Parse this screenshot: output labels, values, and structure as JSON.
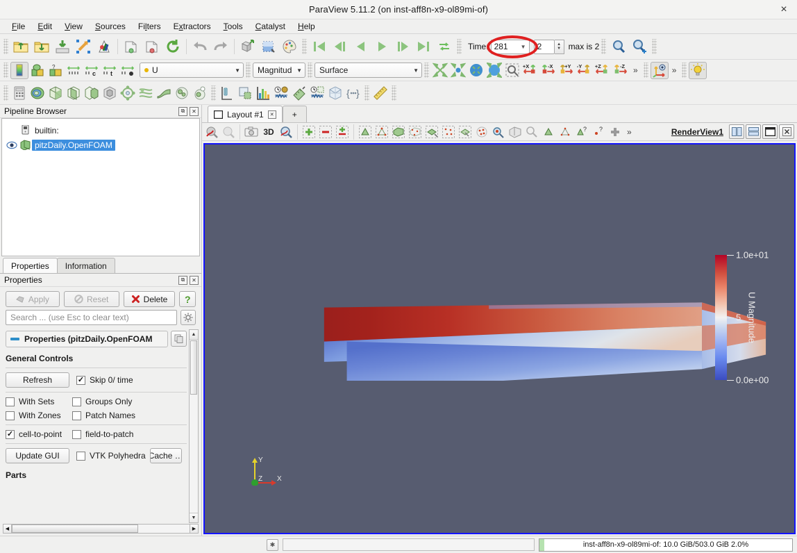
{
  "window": {
    "title": "ParaView 5.11.2 (on inst-aff8n-x9-ol89mi-of)",
    "close_label": "×"
  },
  "menubar": {
    "items": [
      {
        "label": "File",
        "mnemonic": "F"
      },
      {
        "label": "Edit",
        "mnemonic": "E"
      },
      {
        "label": "View",
        "mnemonic": "V"
      },
      {
        "label": "Sources",
        "mnemonic": "S"
      },
      {
        "label": "Filters",
        "mnemonic": "l"
      },
      {
        "label": "Extractors",
        "mnemonic": "x"
      },
      {
        "label": "Tools",
        "mnemonic": "T"
      },
      {
        "label": "Catalyst",
        "mnemonic": "C"
      },
      {
        "label": "Help",
        "mnemonic": "H"
      }
    ]
  },
  "main_toolbar": {
    "icons": [
      "open-file-icon",
      "save-state-icon",
      "save-data-icon",
      "connect-icon",
      "disconnect-icon",
      "load-state-icon",
      "save-screenshot-icon",
      "reset-session-icon",
      "undo-icon",
      "redo-icon",
      "undo-camera-icon",
      "redo-camera-icon",
      "edit-color-map-icon"
    ],
    "vcr": [
      "first-frame-icon",
      "previous-frame-icon",
      "play-reverse-icon",
      "play-icon",
      "next-frame-icon",
      "last-frame-icon",
      "loop-icon"
    ],
    "time_label": "Time:",
    "time_value": "281",
    "frame_index": "2",
    "max_label": "max is 2",
    "zoom_icons": [
      "find-data-icon",
      "zoom-to-data-icon"
    ],
    "annotation_color": "#e02020"
  },
  "representation_toolbar": {
    "icons": [
      "color-legend-icon",
      "rescale-to-data-icon",
      "rescale-custom-icon",
      "rescale-temporal-icon",
      "rescale-visible-icon",
      "rescale-over-time-icon"
    ],
    "array": {
      "value": "U",
      "point_marker_color": "#e8b500"
    },
    "component": {
      "value": "Magnitude"
    },
    "representation": {
      "value": "Surface"
    },
    "camera_icons": [
      "reset-camera-icon",
      "zoom-to-box-icon",
      "rotate-90-icon",
      "center-axes-icon",
      "select-zoom-icon"
    ],
    "axis_buttons": [
      "+X",
      "-X",
      "+Y",
      "-Y",
      "+Z",
      "-Z"
    ],
    "overflow": "»",
    "toggles": [
      "show-orientation-axes-icon",
      "enable-lighting-icon"
    ]
  },
  "filters_toolbar": {
    "icons": [
      "calculator-icon",
      "contour-icon",
      "clip-icon",
      "slice-icon",
      "threshold-icon",
      "extract-subset-icon",
      "glyph-icon",
      "stream-tracer-icon",
      "warp-icon",
      "group-datasets-icon",
      "extract-level-icon",
      "plot-over-line-icon",
      "extract-selection-icon",
      "histogram-icon",
      "plot-data-over-time-icon",
      "plot-selection-over-time-icon",
      "spreadsheet-icon",
      "python-script-icon",
      "ruler-icon"
    ]
  },
  "pipeline_browser": {
    "title": "Pipeline Browser",
    "panel_buttons": [
      "undock-icon",
      "close-icon"
    ],
    "nodes": [
      {
        "label": "builtin:",
        "icon": "server-icon",
        "selected": false,
        "visible": false
      },
      {
        "label": "pitzDaily.OpenFOAM",
        "icon": "geometry-icon",
        "selected": true,
        "visible": true
      }
    ],
    "selection_color": "#3c8ede"
  },
  "properties_panel": {
    "tabs": [
      {
        "label": "Properties",
        "active": true
      },
      {
        "label": "Information",
        "active": false
      }
    ],
    "title": "Properties",
    "panel_buttons": [
      "undock-icon",
      "close-icon"
    ],
    "buttons": {
      "apply": {
        "label": "Apply",
        "enabled": false
      },
      "reset": {
        "label": "Reset",
        "enabled": false
      },
      "delete": {
        "label": "Delete",
        "enabled": true
      },
      "help": {
        "label": "?",
        "enabled": true
      }
    },
    "search_placeholder": "Search ... (use Esc to clear text)",
    "group_header": "Properties (pitzDaily.OpenFOAM",
    "section_title": "General Controls",
    "controls": {
      "refresh_label": "Refresh",
      "skip_zero": {
        "label": "Skip 0/ time",
        "checked": true
      },
      "with_sets": {
        "label": "With Sets",
        "checked": false
      },
      "groups_only": {
        "label": "Groups Only",
        "checked": false
      },
      "with_zones": {
        "label": "With Zones",
        "checked": false
      },
      "patch_names": {
        "label": "Patch Names",
        "checked": false
      },
      "cell_to_point": {
        "label": "cell-to-point",
        "checked": true
      },
      "field_to_patch": {
        "label": "field-to-patch",
        "checked": false
      },
      "update_gui_label": "Update GUI",
      "vtk_polyhedra": {
        "label": "VTK Polyhedra",
        "checked": false
      },
      "cache_label": "Cache …",
      "parts_label": "Parts"
    }
  },
  "layout": {
    "tabs": [
      {
        "label": "Layout #1",
        "active": true
      }
    ],
    "new_tab_label": "+"
  },
  "view_toolbar": {
    "icons": [
      "interactive-select-icon",
      "select-block-icon",
      "screenshot-icon"
    ],
    "mode_label": "3D",
    "more_icons": [
      "zoom-closest-icon",
      "add-icon",
      "subtract-icon",
      "toggle-icon",
      "select-surface-cells-icon",
      "select-surface-points-icon",
      "select-frustum-cells-icon",
      "select-frustum-points-icon",
      "select-blocks-icon",
      "select-points-polygon-icon",
      "interactive-select-cells-icon",
      "hover-cells-icon",
      "hover-points-icon",
      "plus-icon"
    ],
    "overflow": "»",
    "view_name": "RenderView1",
    "window_buttons": [
      "split-horizontal-icon",
      "split-vertical-icon",
      "maximize-icon",
      "close-view-icon"
    ]
  },
  "render_view": {
    "background_color": "#575c70",
    "active_border_color": "#1414ff",
    "orientation_axes": {
      "x": "X",
      "y": "Y",
      "z": "Z",
      "x_color": "#d93a2b",
      "y_color": "#e6d32a",
      "z_color": "#2ea02e"
    },
    "color_legend": {
      "title": "U Magnitude",
      "labels": [
        "1.0e+01",
        "5",
        "0.0e+00"
      ],
      "min": "0.0e+00",
      "max": "1.0e+01",
      "preset": "Cool to Warm",
      "low_color": "#3b4cc0",
      "mid_color": "#f2f2f2",
      "high_color": "#b40426"
    }
  },
  "status_bar": {
    "progress_abort_label": "✱",
    "memory_text": "inst-aff8n-x9-ol89mi-of: 10.0 GiB/503.0 GiB 2.0%",
    "memory_percent": 2.0,
    "memory_fill_color": "#b6e2b0"
  }
}
